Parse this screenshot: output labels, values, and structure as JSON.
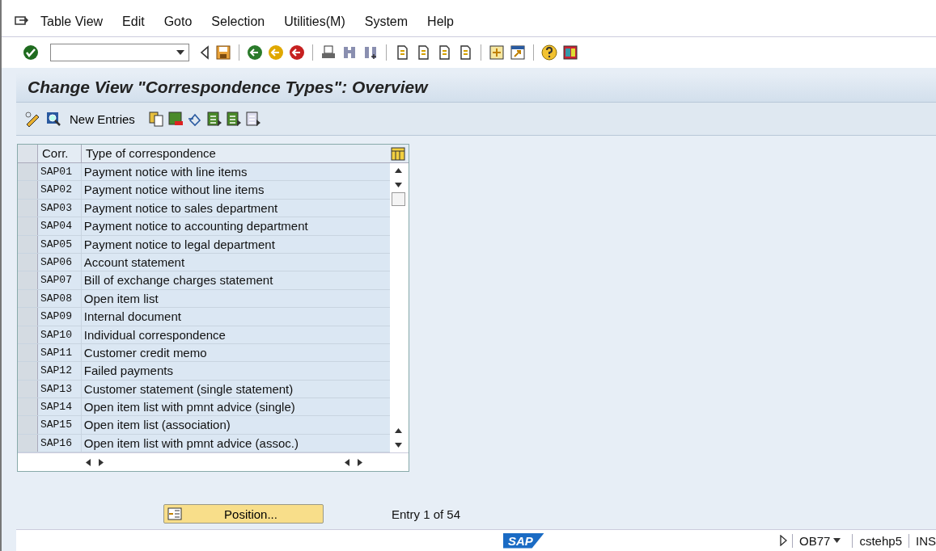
{
  "menu": [
    "Table View",
    "Edit",
    "Goto",
    "Selection",
    "Utilities(M)",
    "System",
    "Help"
  ],
  "title": "Change View \"Correspondence Types\": Overview",
  "app_toolbar": {
    "new_entries": "New Entries"
  },
  "table": {
    "columns": [
      "Corr.",
      "Type of correspondence"
    ],
    "rows": [
      {
        "code": "SAP01",
        "text": "Payment notice with line items",
        "selected": false
      },
      {
        "code": "SAP02",
        "text": "Payment notice without line items",
        "selected": false
      },
      {
        "code": "SAP03",
        "text": "Payment notice to sales department",
        "selected": false
      },
      {
        "code": "SAP04",
        "text": "Payment notice to accounting department",
        "selected": false
      },
      {
        "code": "SAP05",
        "text": "Payment notice to legal department",
        "selected": false
      },
      {
        "code": "SAP06",
        "text": "Account statement",
        "selected": false
      },
      {
        "code": "SAP07",
        "text": "Bill of exchange charges statement",
        "selected": false
      },
      {
        "code": "SAP08",
        "text": "Open item list",
        "selected": false
      },
      {
        "code": "SAP09",
        "text": "Internal document",
        "selected": false
      },
      {
        "code": "SAP10",
        "text": "Individual correspondence",
        "selected": false
      },
      {
        "code": "SAP11",
        "text": "Customer credit memo",
        "selected": false
      },
      {
        "code": "SAP12",
        "text": "Failed payments",
        "selected": false
      },
      {
        "code": "SAP13",
        "text": "Customer statement (single statement)",
        "selected": false
      },
      {
        "code": "SAP14",
        "text": "Open item list with pmnt advice (single)",
        "selected": false
      },
      {
        "code": "SAP15",
        "text": "Open item list (association)",
        "selected": false
      },
      {
        "code": "SAP16",
        "text": "Open item list with pmnt advice (assoc.)",
        "selected": false
      }
    ]
  },
  "position_button": "Position...",
  "entry_info": "Entry 1 of 54",
  "status_bar": {
    "logo": "SAP",
    "transaction": "OB77",
    "server": "cstehp5",
    "mode": "INS"
  }
}
